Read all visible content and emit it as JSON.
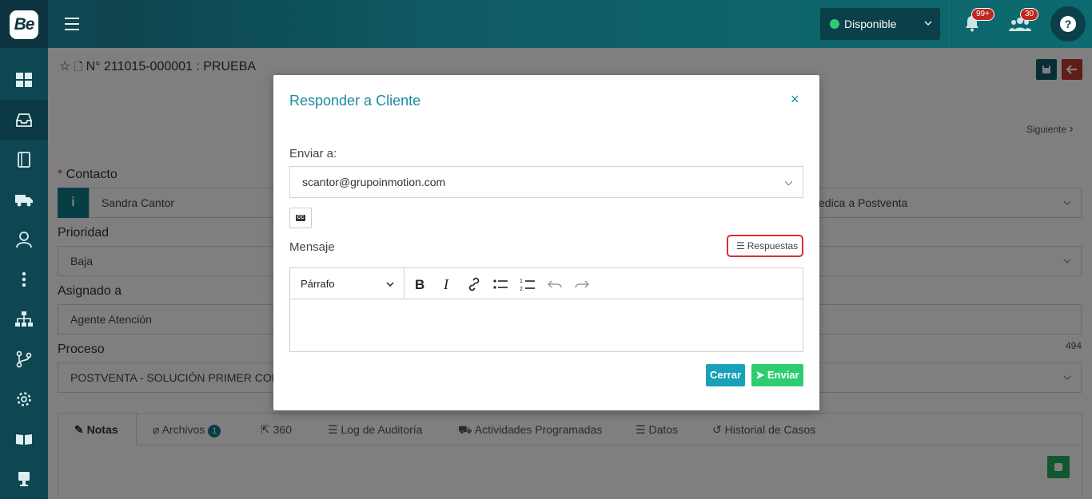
{
  "app": {
    "logo_text": "Be"
  },
  "topbar": {
    "status_label": "Disponible",
    "notifications_count": "99+",
    "users_count": "30",
    "help_label": "?"
  },
  "case": {
    "title": "N° 211015-000001 : PRUEBA",
    "next_label": "Siguiente"
  },
  "form": {
    "contact_label": "Contacto",
    "contact_value": "Sandra Cantor",
    "right_field_value": "edica a Postventa",
    "priority_label": "Prioridad",
    "priority_value": "Baja",
    "assigned_label": "Asignado a",
    "assigned_value": "Agente Atención",
    "process_label": "Proceso",
    "process_value": "POSTVENTA - SOLUCIÓN PRIMER CON",
    "char_count": "494",
    "info_icon_text": "i"
  },
  "tabs": [
    {
      "label": "Notas"
    },
    {
      "label": "Archivos",
      "badge": "1"
    },
    {
      "label": "360"
    },
    {
      "label": "Log de Auditoría"
    },
    {
      "label": "Actividades Programadas"
    },
    {
      "label": "Datos"
    },
    {
      "label": "Historial de Casos"
    }
  ],
  "modal": {
    "title": "Responder a Cliente",
    "close_label": "×",
    "send_to_label": "Enviar a:",
    "send_to_value": "scantor@grupoinmotion.com",
    "cc_label": "CC",
    "message_label": "Mensaje",
    "responses_label": "Respuestas",
    "paragraph_label": "Párrafo",
    "close_button": "Cerrar",
    "send_button": "Enviar"
  },
  "colors": {
    "accent": "#1a8c9c",
    "sidebar": "#0e4652",
    "send": "#2ecc71",
    "close": "#17a2b8",
    "highlight": "#d93030"
  }
}
